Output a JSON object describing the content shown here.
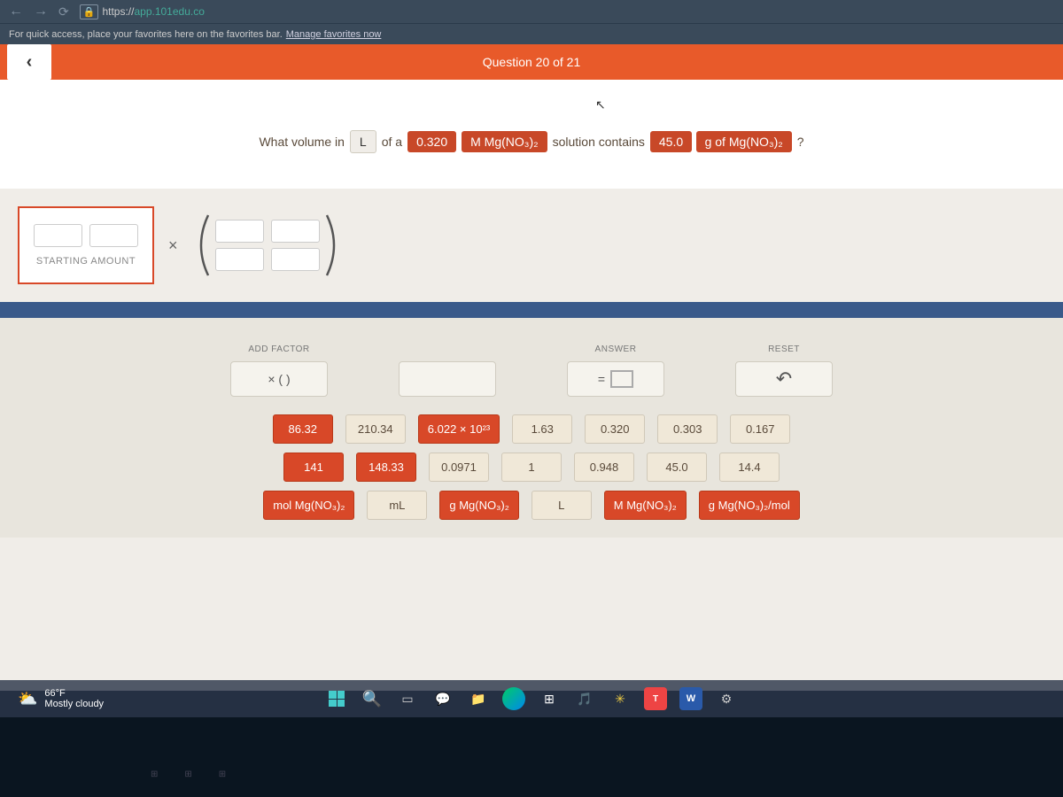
{
  "browser": {
    "url_prefix": "https://",
    "url_domain": "app.101edu.co",
    "favorites_text": "For quick access, place your favorites here on the favorites bar.",
    "favorites_link": "Manage favorites now"
  },
  "header": {
    "question_title": "Question 20 of 21"
  },
  "question": {
    "text1": "What volume in",
    "pill_L": "L",
    "text2": "of a",
    "pill_molarity": "0.320",
    "pill_compound": "M Mg(NO₃)₂",
    "text3": "solution contains",
    "pill_mass": "45.0",
    "pill_mass_unit": "g of Mg(NO₃)₂",
    "text4": "?"
  },
  "equation": {
    "starting_label": "STARTING AMOUNT",
    "multiply": "×"
  },
  "controls": {
    "add_factor_label": "ADD FACTOR",
    "add_factor_content": "× (  )",
    "answer_label": "ANSWER",
    "answer_eq": "=",
    "reset_label": "RESET",
    "reset_symbol": "↶"
  },
  "tiles": {
    "row1": [
      "86.32",
      "210.34",
      "6.022 × 10²³",
      "1.63",
      "0.320",
      "0.303",
      "0.167"
    ],
    "row2": [
      "141",
      "148.33",
      "0.0971",
      "1",
      "0.948",
      "45.0",
      "14.4"
    ],
    "row3": [
      "mol Mg(NO₃)₂",
      "mL",
      "g Mg(NO₃)₂",
      "L",
      "M Mg(NO₃)₂",
      "g Mg(NO₃)₂/mol"
    ]
  },
  "tiles_style": {
    "row1": [
      "orange",
      "tan",
      "orange",
      "tan",
      "tan",
      "tan",
      "tan"
    ],
    "row2": [
      "orange",
      "orange",
      "tan",
      "tan",
      "tan",
      "tan",
      "tan"
    ],
    "row3": [
      "orange",
      "tan",
      "orange",
      "tan",
      "orange",
      "orange"
    ]
  },
  "taskbar": {
    "temp": "66°F",
    "condition": "Mostly cloudy"
  }
}
